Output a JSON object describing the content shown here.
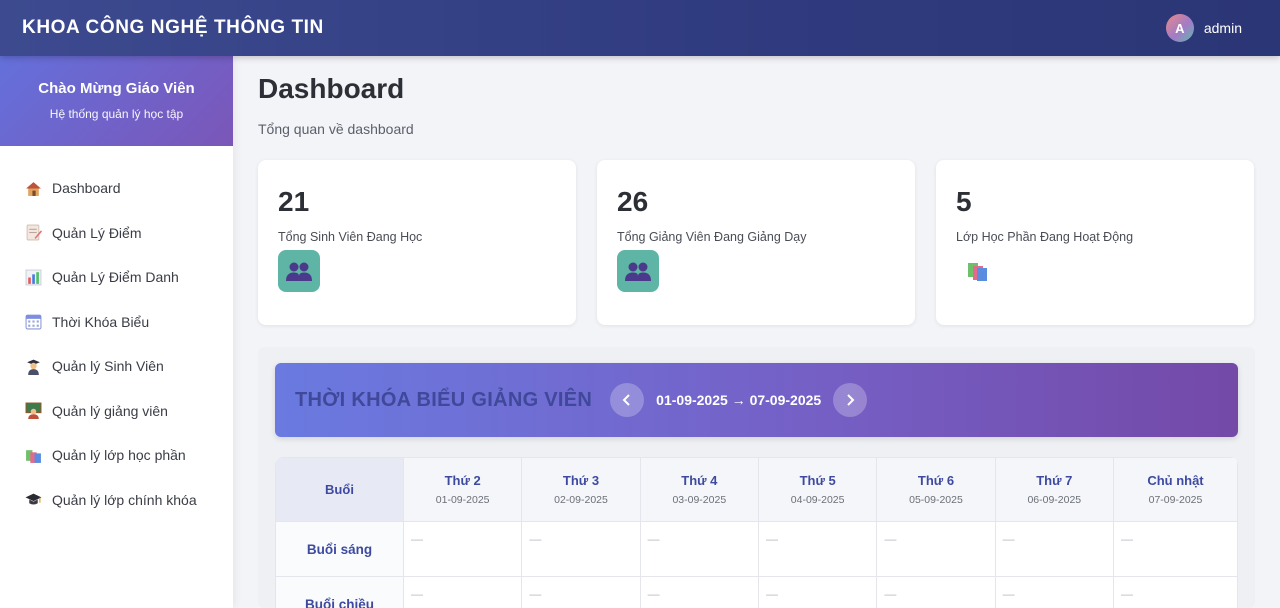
{
  "header": {
    "title": "KHOA CÔNG NGHỆ THÔNG TIN",
    "avatar_letter": "A",
    "username": "admin"
  },
  "sidebar": {
    "welcome": "Chào Mừng Giáo Viên",
    "subtitle": "Hệ thống quản lý học tập",
    "items": [
      {
        "label": "Dashboard",
        "icon": "house-icon"
      },
      {
        "label": "Quản Lý Điểm",
        "icon": "memo-icon"
      },
      {
        "label": "Quản Lý Điểm Danh",
        "icon": "bar-chart-icon"
      },
      {
        "label": "Thời Khóa Biểu",
        "icon": "calendar-icon"
      },
      {
        "label": "Quản lý Sinh Viên",
        "icon": "student-icon"
      },
      {
        "label": "Quản lý giảng viên",
        "icon": "teacher-icon"
      },
      {
        "label": "Quản lý lớp học phần",
        "icon": "books-icon"
      },
      {
        "label": "Quản lý lớp chính khóa",
        "icon": "graduation-cap-icon"
      }
    ]
  },
  "page": {
    "title": "Dashboard",
    "subtitle": "Tổng quan về dashboard"
  },
  "stats": [
    {
      "value": "21",
      "label": "Tổng Sinh Viên Đang Học",
      "icon": "people-icon"
    },
    {
      "value": "26",
      "label": "Tổng Giảng Viên Đang Giảng Dạy",
      "icon": "people-icon"
    },
    {
      "value": "5",
      "label": "Lớp Học Phần Đang Hoạt Động",
      "icon": "books-icon"
    }
  ],
  "schedule": {
    "title": "THỜI KHÓA BIỂU GIẢNG VIÊN",
    "range": "01-09-2025 → 07-09-2025",
    "session_header": "Buổi",
    "days": [
      {
        "name": "Thứ 2",
        "date": "01-09-2025"
      },
      {
        "name": "Thứ 3",
        "date": "02-09-2025"
      },
      {
        "name": "Thứ 4",
        "date": "03-09-2025"
      },
      {
        "name": "Thứ 5",
        "date": "04-09-2025"
      },
      {
        "name": "Thứ 6",
        "date": "05-09-2025"
      },
      {
        "name": "Thứ 7",
        "date": "06-09-2025"
      },
      {
        "name": "Chủ nhật",
        "date": "07-09-2025"
      }
    ],
    "sessions": [
      "Buổi sáng",
      "Buổi chiều"
    ],
    "empty": "—"
  },
  "colors": {
    "header": "#2f3b7e",
    "accent": "#6470db",
    "icon_teal": "#5fb5a5"
  }
}
